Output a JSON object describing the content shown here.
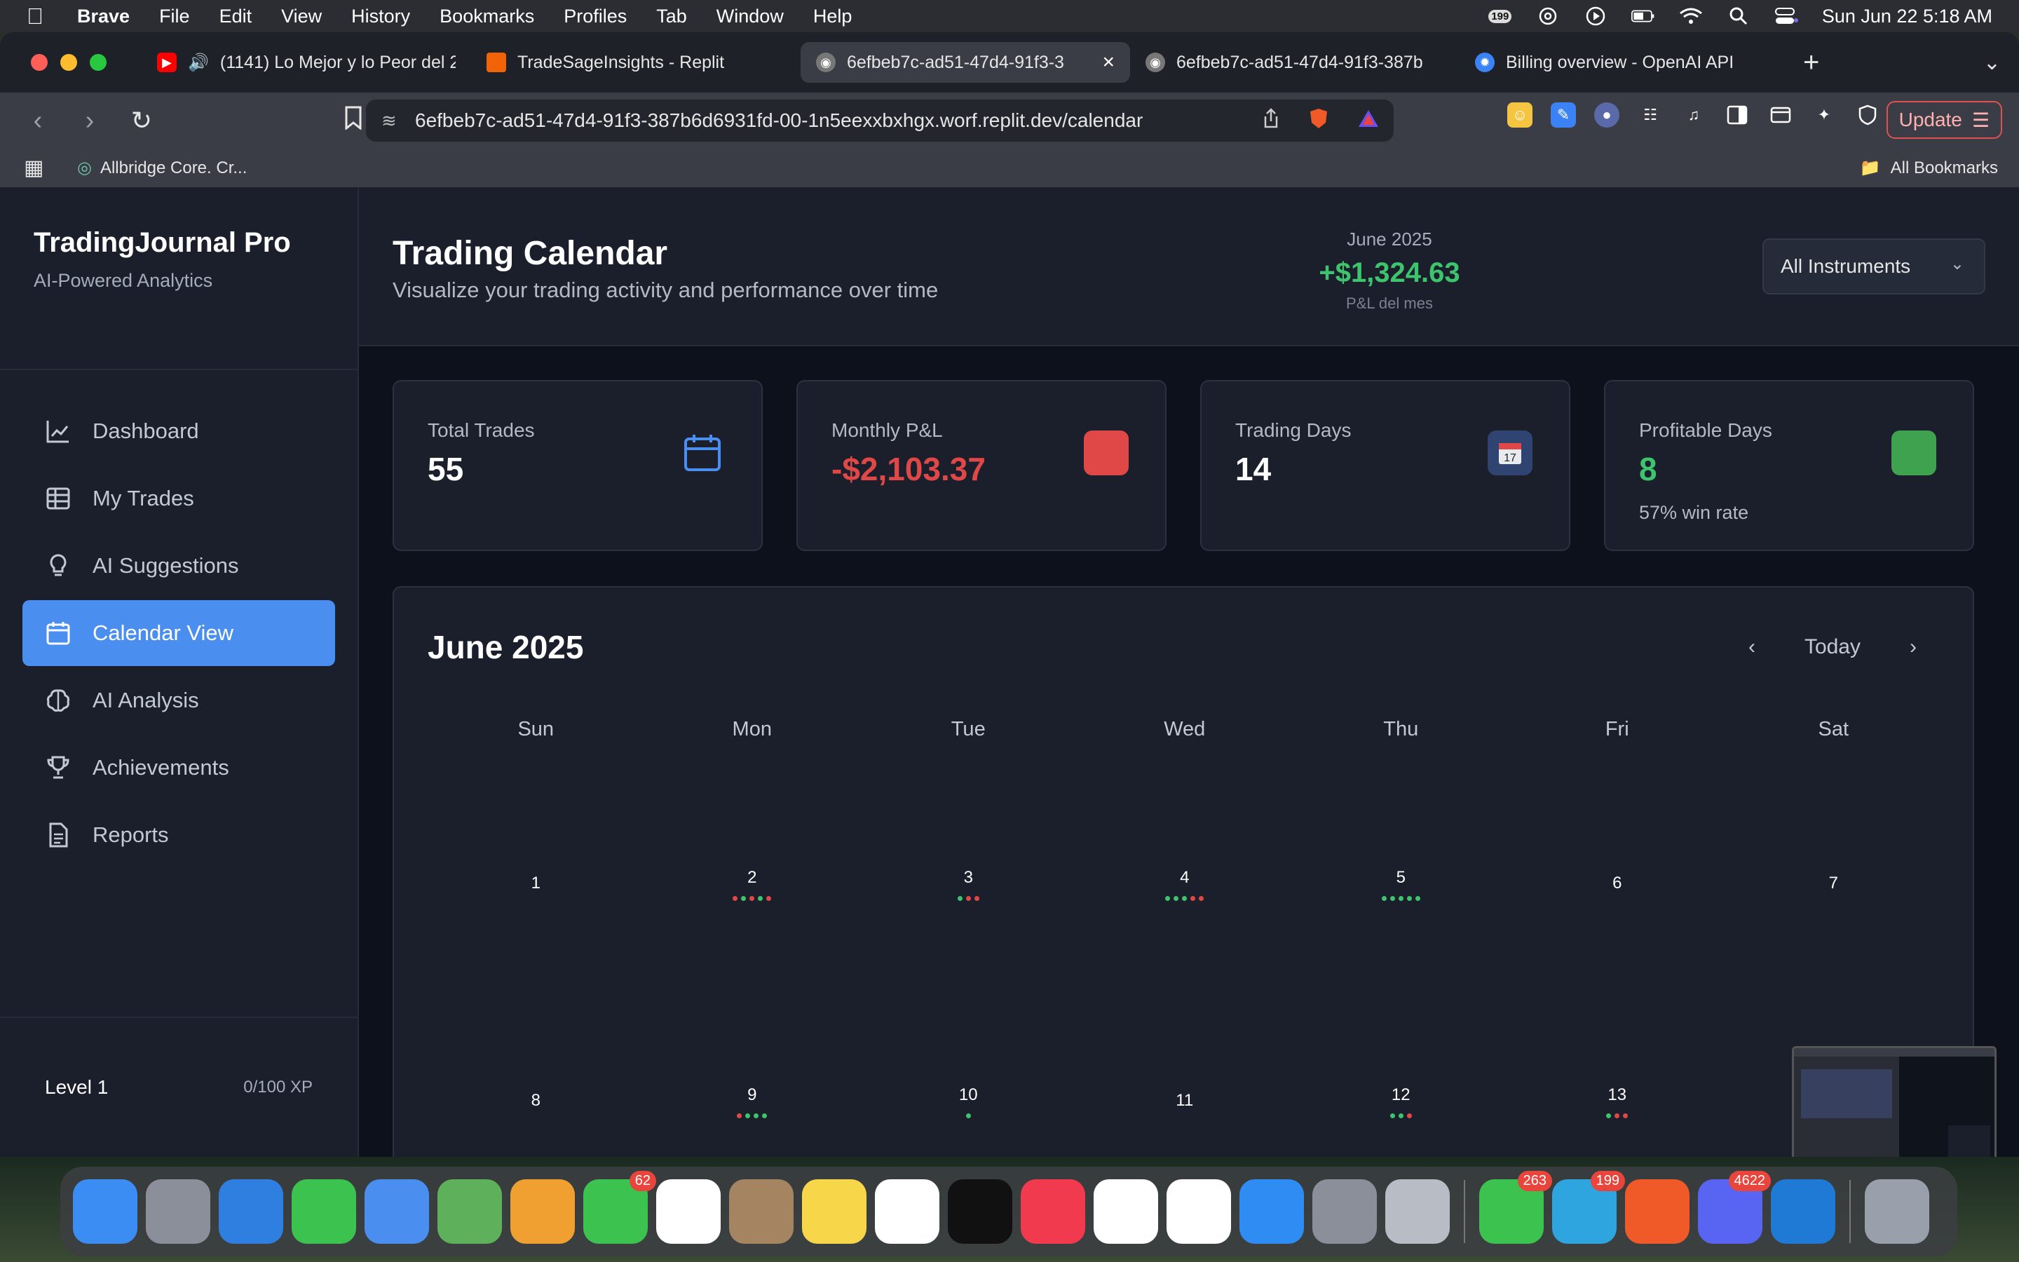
{
  "menubar": {
    "app": "Brave",
    "items": [
      "File",
      "Edit",
      "View",
      "History",
      "Bookmarks",
      "Profiles",
      "Tab",
      "Window",
      "Help"
    ],
    "badge_count": "199",
    "clock": "Sun Jun 22  5:18 AM"
  },
  "tabs": [
    {
      "title": "(1141) Lo Mejor y lo Peor del 2",
      "fav_color": "#ff0000",
      "active": false
    },
    {
      "title": "TradeSageInsights - Replit",
      "fav_color": "#f26207",
      "active": false
    },
    {
      "title": "6efbeb7c-ad51-47d4-91f3-3",
      "fav_color": "#888888",
      "active": true
    },
    {
      "title": "6efbeb7c-ad51-47d4-91f3-387b",
      "fav_color": "#888888",
      "active": false
    },
    {
      "title": "Billing overview - OpenAI API",
      "fav_color": "#3b82f6",
      "active": false
    }
  ],
  "address": {
    "url": "6efbeb7c-ad51-47d4-91f3-387b6d6931fd-00-1n5eexxbxhgx.worf.replit.dev/calendar",
    "update_label": "Update"
  },
  "bookmarks": {
    "item": "Allbridge Core. Cr...",
    "all": "All Bookmarks"
  },
  "sidebar": {
    "title": "TradingJournal Pro",
    "subtitle": "AI-Powered Analytics",
    "items": [
      {
        "label": "Dashboard",
        "icon": "chart-line-icon",
        "active": false
      },
      {
        "label": "My Trades",
        "icon": "table-icon",
        "active": false
      },
      {
        "label": "AI Suggestions",
        "icon": "lightbulb-icon",
        "active": false
      },
      {
        "label": "Calendar View",
        "icon": "calendar-icon",
        "active": true
      },
      {
        "label": "AI Analysis",
        "icon": "brain-icon",
        "active": false
      },
      {
        "label": "Achievements",
        "icon": "trophy-icon",
        "active": false
      },
      {
        "label": "Reports",
        "icon": "document-icon",
        "active": false
      }
    ],
    "level_label": "Level 1",
    "level_xp": "0/100 XP"
  },
  "header": {
    "title": "Trading Calendar",
    "subtitle": "Visualize your trading activity and performance over time",
    "month_label": "June 2025",
    "month_pnl": "+$1,324.63",
    "month_pnl_sub": "P&L del mes",
    "instrument_select": "All Instruments"
  },
  "stats": [
    {
      "label": "Total Trades",
      "value": "55",
      "extra": "",
      "tone": "white",
      "icon": "calendar-outline-icon"
    },
    {
      "label": "Monthly P&L",
      "value": "-$2,103.37",
      "extra": "",
      "tone": "red",
      "icon": "red-square-icon"
    },
    {
      "label": "Trading Days",
      "value": "14",
      "extra": "",
      "tone": "white",
      "icon": "calendar-date-icon"
    },
    {
      "label": "Profitable Days",
      "value": "8",
      "extra": "57% win rate",
      "tone": "green",
      "icon": "green-square-icon"
    }
  ],
  "calendar": {
    "title": "June 2025",
    "today_label": "Today",
    "weekdays": [
      "Sun",
      "Mon",
      "Tue",
      "Wed",
      "Thu",
      "Fri",
      "Sat"
    ],
    "weeks": [
      [
        {
          "day": "1",
          "dots": []
        },
        {
          "day": "2",
          "dots": [
            "#e04848",
            "#3ec46d",
            "#e04848",
            "#3ec46d",
            "#e04848"
          ]
        },
        {
          "day": "3",
          "dots": [
            "#3ec46d",
            "#e04848",
            "#e04848"
          ]
        },
        {
          "day": "4",
          "dots": [
            "#3ec46d",
            "#3ec46d",
            "#3ec46d",
            "#e04848",
            "#e04848"
          ]
        },
        {
          "day": "5",
          "dots": [
            "#3ec46d",
            "#3ec46d",
            "#3ec46d",
            "#3ec46d",
            "#3ec46d"
          ]
        },
        {
          "day": "6",
          "dots": []
        },
        {
          "day": "7",
          "dots": []
        }
      ],
      [
        {
          "day": "8",
          "dots": []
        },
        {
          "day": "9",
          "dots": [
            "#e04848",
            "#3ec46d",
            "#3ec46d",
            "#3ec46d"
          ]
        },
        {
          "day": "10",
          "dots": [
            "#3ec46d"
          ]
        },
        {
          "day": "11",
          "dots": []
        },
        {
          "day": "12",
          "dots": [
            "#3ec46d",
            "#3ec46d",
            "#e04848"
          ]
        },
        {
          "day": "13",
          "dots": [
            "#3ec46d",
            "#e04848",
            "#e04848"
          ]
        },
        {
          "day": "",
          "dots": []
        }
      ]
    ]
  },
  "dock": [
    {
      "name": "finder-icon",
      "color": "#3b8cf3",
      "badge": ""
    },
    {
      "name": "launchpad-icon",
      "color": "#8a8f99",
      "badge": ""
    },
    {
      "name": "safari-icon",
      "color": "#2f7fe0",
      "badge": ""
    },
    {
      "name": "messages-icon",
      "color": "#3cc24f",
      "badge": ""
    },
    {
      "name": "mail-icon",
      "color": "#4a8ef0",
      "badge": ""
    },
    {
      "name": "maps-icon",
      "color": "#5fb05a",
      "badge": ""
    },
    {
      "name": "photos-icon",
      "color": "#f0a030",
      "badge": ""
    },
    {
      "name": "facetime-icon",
      "color": "#3cc24f",
      "badge": "62"
    },
    {
      "name": "calendar-app-icon",
      "color": "#ffffff",
      "badge": ""
    },
    {
      "name": "contacts-icon",
      "color": "#a58462",
      "badge": ""
    },
    {
      "name": "notes-icon",
      "color": "#f7d64a",
      "badge": ""
    },
    {
      "name": "freeform-icon",
      "color": "#ffffff",
      "badge": ""
    },
    {
      "name": "tv-icon",
      "color": "#111111",
      "badge": ""
    },
    {
      "name": "music-icon",
      "color": "#f23a4e",
      "badge": ""
    },
    {
      "name": "news-icon",
      "color": "#ffffff",
      "badge": ""
    },
    {
      "name": "reminders-icon",
      "color": "#ffffff",
      "badge": ""
    },
    {
      "name": "app-store-icon",
      "color": "#2f8cf3",
      "badge": ""
    },
    {
      "name": "settings-icon",
      "color": "#8a8f99",
      "badge": ""
    },
    {
      "name": "iphone-mirroring-icon",
      "color": "#b8bcc4",
      "badge": ""
    },
    {
      "name": "whatsapp-icon",
      "color": "#3cc24f",
      "badge": "263"
    },
    {
      "name": "telegram-icon",
      "color": "#2fa5e0",
      "badge": "199"
    },
    {
      "name": "brave-icon",
      "color": "#f05a28",
      "badge": ""
    },
    {
      "name": "discord-icon",
      "color": "#5865f2",
      "badge": "4622"
    },
    {
      "name": "vscode-icon",
      "color": "#1f7ad6",
      "badge": ""
    },
    {
      "name": "trash-icon",
      "color": "#9aa0ab",
      "badge": ""
    }
  ]
}
